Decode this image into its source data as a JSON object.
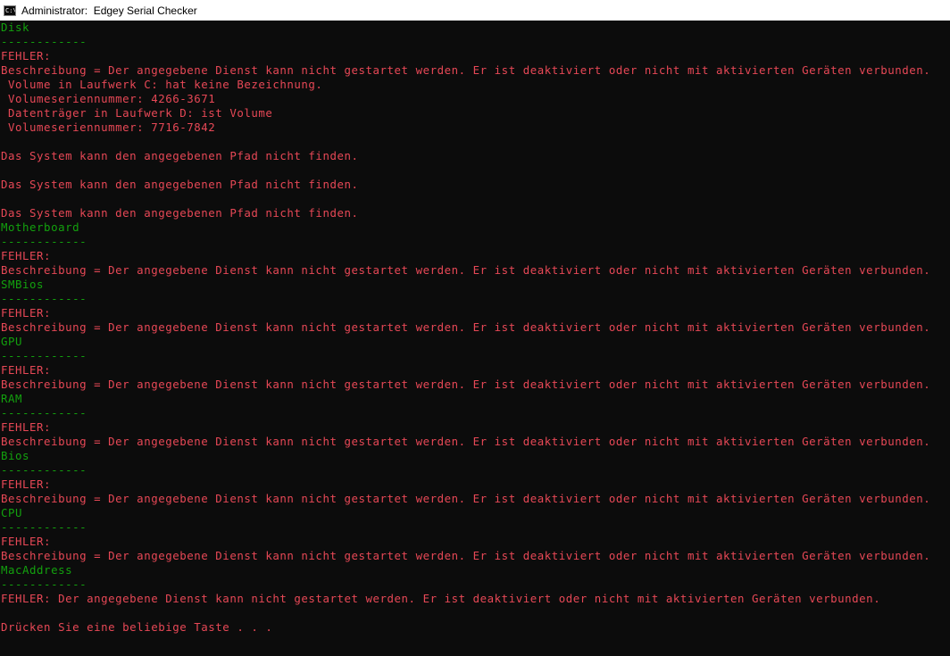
{
  "window": {
    "title": "Administrator:  Edgey Serial Checker",
    "icon": "console-icon"
  },
  "console": {
    "lines": [
      {
        "text": "Disk",
        "color": "green"
      },
      {
        "text": "------------",
        "color": "green"
      },
      {
        "text": "FEHLER:",
        "color": "red"
      },
      {
        "text": "Beschreibung = Der angegebene Dienst kann nicht gestartet werden. Er ist deaktiviert oder nicht mit aktivierten Geräten verbunden.",
        "color": "red"
      },
      {
        "text": " Volume in Laufwerk C: hat keine Bezeichnung.",
        "color": "red"
      },
      {
        "text": " Volumeseriennummer: 4266-3671",
        "color": "red"
      },
      {
        "text": " Datenträger in Laufwerk D: ist Volume",
        "color": "red"
      },
      {
        "text": " Volumeseriennummer: 7716-7842",
        "color": "red"
      },
      {
        "text": "",
        "color": "red"
      },
      {
        "text": "Das System kann den angegebenen Pfad nicht finden.",
        "color": "red"
      },
      {
        "text": "",
        "color": "red"
      },
      {
        "text": "Das System kann den angegebenen Pfad nicht finden.",
        "color": "red"
      },
      {
        "text": "",
        "color": "red"
      },
      {
        "text": "Das System kann den angegebenen Pfad nicht finden.",
        "color": "red"
      },
      {
        "text": "Motherboard",
        "color": "green"
      },
      {
        "text": "------------",
        "color": "green"
      },
      {
        "text": "FEHLER:",
        "color": "red"
      },
      {
        "text": "Beschreibung = Der angegebene Dienst kann nicht gestartet werden. Er ist deaktiviert oder nicht mit aktivierten Geräten verbunden.",
        "color": "red"
      },
      {
        "text": "SMBios",
        "color": "green"
      },
      {
        "text": "------------",
        "color": "green"
      },
      {
        "text": "FEHLER:",
        "color": "red"
      },
      {
        "text": "Beschreibung = Der angegebene Dienst kann nicht gestartet werden. Er ist deaktiviert oder nicht mit aktivierten Geräten verbunden.",
        "color": "red"
      },
      {
        "text": "GPU",
        "color": "green"
      },
      {
        "text": "------------",
        "color": "green"
      },
      {
        "text": "FEHLER:",
        "color": "red"
      },
      {
        "text": "Beschreibung = Der angegebene Dienst kann nicht gestartet werden. Er ist deaktiviert oder nicht mit aktivierten Geräten verbunden.",
        "color": "red"
      },
      {
        "text": "RAM",
        "color": "green"
      },
      {
        "text": "------------",
        "color": "green"
      },
      {
        "text": "FEHLER:",
        "color": "red"
      },
      {
        "text": "Beschreibung = Der angegebene Dienst kann nicht gestartet werden. Er ist deaktiviert oder nicht mit aktivierten Geräten verbunden.",
        "color": "red"
      },
      {
        "text": "Bios",
        "color": "green"
      },
      {
        "text": "------------",
        "color": "green"
      },
      {
        "text": "FEHLER:",
        "color": "red"
      },
      {
        "text": "Beschreibung = Der angegebene Dienst kann nicht gestartet werden. Er ist deaktiviert oder nicht mit aktivierten Geräten verbunden.",
        "color": "red"
      },
      {
        "text": "CPU",
        "color": "green"
      },
      {
        "text": "------------",
        "color": "green"
      },
      {
        "text": "FEHLER:",
        "color": "red"
      },
      {
        "text": "Beschreibung = Der angegebene Dienst kann nicht gestartet werden. Er ist deaktiviert oder nicht mit aktivierten Geräten verbunden.",
        "color": "red"
      },
      {
        "text": "MacAddress",
        "color": "green"
      },
      {
        "text": "------------",
        "color": "green"
      },
      {
        "text": "FEHLER: Der angegebene Dienst kann nicht gestartet werden. Er ist deaktiviert oder nicht mit aktivierten Geräten verbunden.",
        "color": "red"
      },
      {
        "text": "",
        "color": "red"
      },
      {
        "text": "Drücken Sie eine beliebige Taste . . .",
        "color": "red"
      }
    ]
  },
  "colors": {
    "green": "#13a10e",
    "red": "#e74856",
    "background": "#0c0c0c"
  }
}
